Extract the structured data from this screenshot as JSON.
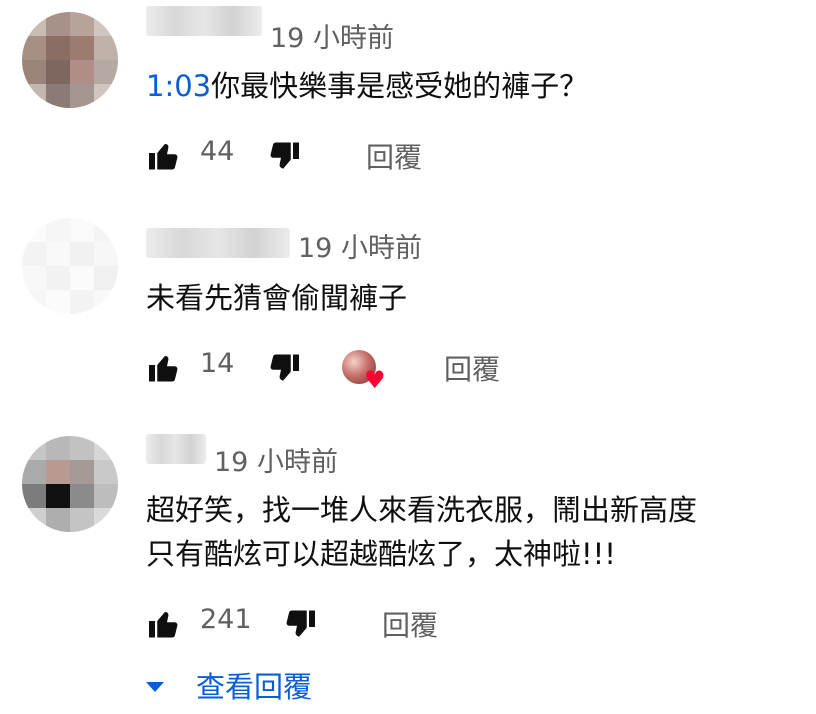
{
  "comments": [
    {
      "time": "19 小時前",
      "timestamp_link": "1:03",
      "text_lines": [
        "你最快樂事是感受她的褲子？"
      ],
      "likes": "44",
      "reply_label": "回覆",
      "icons": {
        "like": "thumbs-up-icon",
        "dislike": "thumbs-down-icon"
      }
    },
    {
      "time": "19 小時前",
      "text_lines": [
        "未看先猜會偷聞褲子"
      ],
      "likes": "14",
      "reply_label": "回覆",
      "creator_heart": true,
      "icons": {
        "like": "thumbs-up-icon",
        "dislike": "thumbs-down-icon",
        "heart": "heart-icon"
      }
    },
    {
      "time": "19 小時前",
      "text_lines": [
        "超好笑，找一堆人來看洗衣服，鬧出新高度",
        "只有酷炫可以超越酷炫了，太神啦!!!"
      ],
      "likes": "241",
      "reply_label": "回覆",
      "icons": {
        "like": "thumbs-up-icon",
        "dislike": "thumbs-down-icon"
      }
    }
  ],
  "view_replies": {
    "label": "查看回覆",
    "icon": "caret-down-icon"
  },
  "colors": {
    "link": "#065fd4",
    "secondary_text": "#606060",
    "heart": "#ff0033"
  }
}
